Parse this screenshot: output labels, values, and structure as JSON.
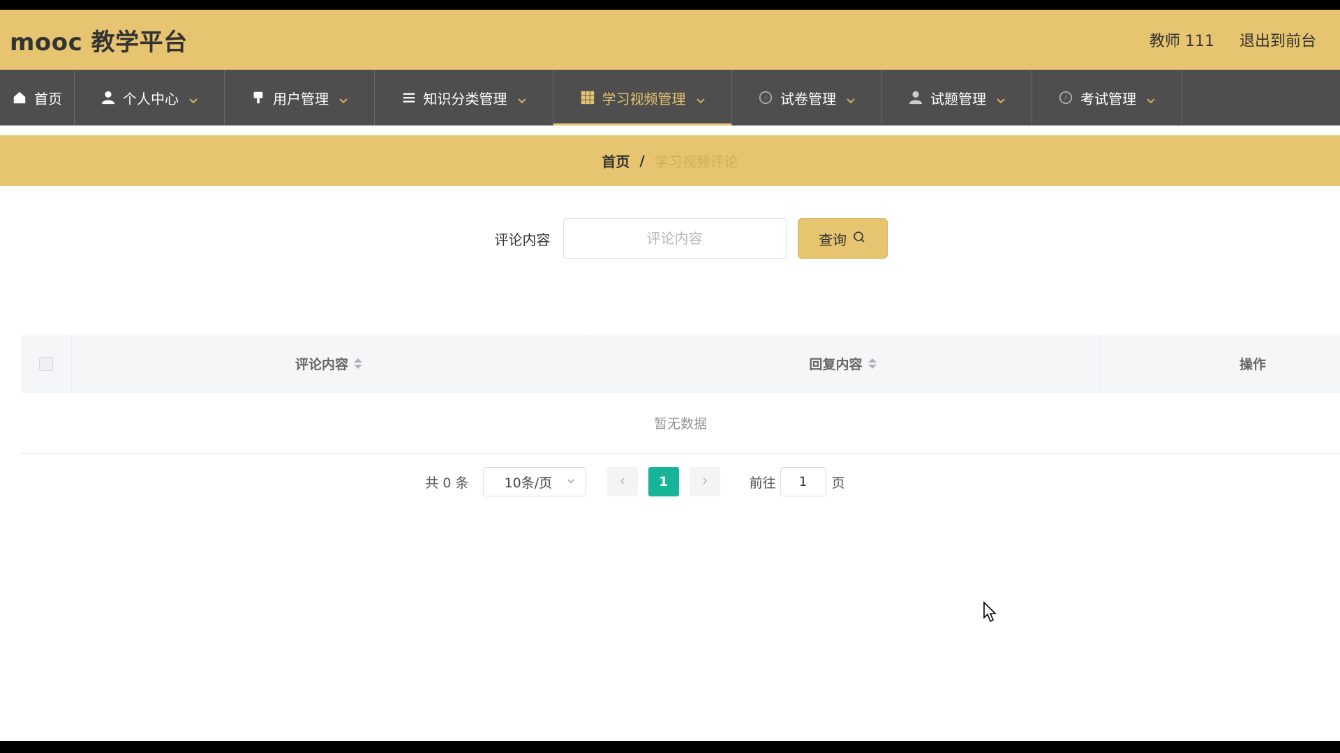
{
  "header": {
    "brand": "mooc 教学平台",
    "user": "教师 111",
    "exit_label": "退出到前台"
  },
  "nav": {
    "items": [
      {
        "label": "首页",
        "icon": "home-icon",
        "dropdown": false
      },
      {
        "label": "个人中心",
        "icon": "user-icon",
        "dropdown": true
      },
      {
        "label": "用户管理",
        "icon": "pin-icon",
        "dropdown": true
      },
      {
        "label": "知识分类管理",
        "icon": "list-icon",
        "dropdown": true
      },
      {
        "label": "学习视频管理",
        "icon": "grid-icon",
        "dropdown": true,
        "active": true
      },
      {
        "label": "试卷管理",
        "icon": "compass-icon",
        "dropdown": true
      },
      {
        "label": "试题管理",
        "icon": "user-icon",
        "dropdown": true
      },
      {
        "label": "考试管理",
        "icon": "compass-icon",
        "dropdown": true
      }
    ]
  },
  "breadcrumb": {
    "home": "首页",
    "separator": "/",
    "current": "学习视频评论"
  },
  "search": {
    "label": "评论内容",
    "placeholder": "评论内容",
    "value": "",
    "button_label": "查询"
  },
  "table": {
    "columns": [
      "评论内容",
      "回复内容",
      "操作"
    ],
    "rows": [],
    "empty_text": "暂无数据"
  },
  "pagination": {
    "total_text": "共 0 条",
    "page_size": "10条/页",
    "current_page": "1",
    "goto_label": "前往",
    "goto_value": "1",
    "page_suffix": "页"
  },
  "colors": {
    "accent": "#e7c570",
    "nav_bg": "#4e4e4e",
    "page_active": "#17b497"
  }
}
